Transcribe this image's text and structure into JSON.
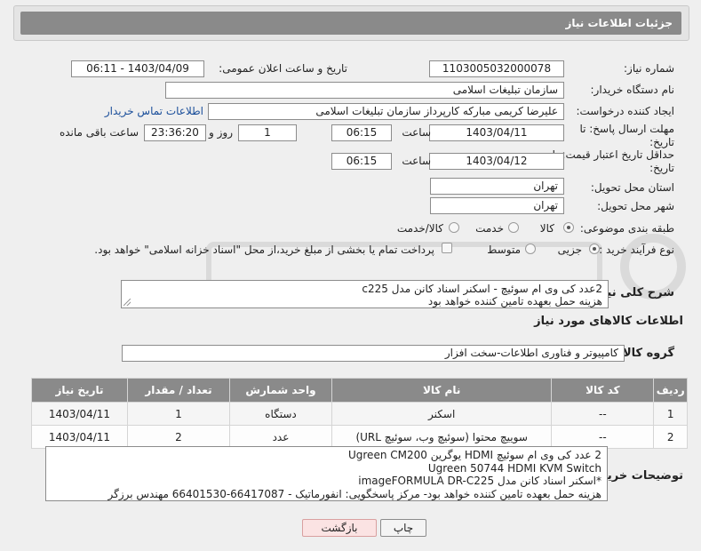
{
  "panel": {
    "title": "جزئیات اطلاعات نیاز"
  },
  "labels": {
    "need_number": "شماره نیاز:",
    "announce_datetime": "تاریخ و ساعت اعلان عمومی:",
    "buyer_org": "نام دستگاه خریدار:",
    "requester": "ایجاد کننده درخواست:",
    "reply_deadline": "مهلت ارسال پاسخ: تا تاریخ:",
    "price_validity": "حداقل تاریخ اعتبار قیمت: تا تاریخ:",
    "hour": "ساعت",
    "day_and": "روز و",
    "remaining": "ساعت باقی مانده",
    "province": "استان محل تحویل:",
    "city": "شهر محل تحویل:",
    "category": "طبقه بندی موضوعی:",
    "purchase_type": "نوع فرآیند خرید :",
    "need_summary": "شرح کلی نیاز:",
    "goods_info": "اطلاعات کالاهای مورد نیاز",
    "goods_group": "گروه کالا:",
    "buyer_notes": "توضیحات خریدار:"
  },
  "fields": {
    "need_number": "1103005032000078",
    "announce_datetime": "1403/04/09 - 06:11",
    "buyer_org": "سازمان تبلیغات اسلامی",
    "requester": "علیرضا کریمی مبارکه کارپرداز سازمان تبلیغات اسلامی",
    "buyer_contact_link": "اطلاعات تماس خریدار",
    "reply_date": "1403/04/11",
    "reply_time": "06:15",
    "reply_days": "1",
    "reply_remaining": "23:36:20",
    "validity_date": "1403/04/12",
    "validity_time": "06:15",
    "province": "تهران",
    "city": "تهران",
    "goods_group": "کامپیوتر و فناوری اطلاعات-سخت افزار"
  },
  "category_options": [
    "کالا",
    "خدمت",
    "کالا/خدمت"
  ],
  "category_selected": "کالا",
  "purchase_options": [
    "جزیی",
    "متوسط"
  ],
  "purchase_selected": "جزیی",
  "payment_note": "پرداخت تمام یا بخشی از مبلغ خرید،از محل \"اسناد خزانه اسلامی\" خواهد بود.",
  "need_summary_lines": [
    "2عدد کی وی ام سوئیچ - اسکنر اسناد کانن مدل c225",
    "هزینه حمل بعهده تامین کننده خواهد بود"
  ],
  "table": {
    "headers": [
      "ردیف",
      "کد کالا",
      "نام کالا",
      "واحد شمارش",
      "تعداد / مقدار",
      "تاریخ نیاز"
    ],
    "rows": [
      [
        "1",
        "--",
        "اسکنر",
        "دستگاه",
        "1",
        "1403/04/11"
      ],
      [
        "2",
        "--",
        "سوییچ محتوا (سوئیچ وب، سوئیچ URL)",
        "عدد",
        "2",
        "1403/04/11"
      ]
    ]
  },
  "buyer_notes_lines": [
    "2 عدد کی وی ام سوئیچ HDMI یوگرین Ugreen CM200",
    "Ugreen 50744 HDMI KVM Switch",
    "*اسکنر اسناد کانن مدل imageFORMULA DR-C225",
    "هزینه حمل بعهده تامین کننده خواهد بود- مرکز پاسخگویی: انفورماتیک - 66417087-66401530 مهندس برزگر"
  ],
  "buttons": {
    "print": "چاپ",
    "back": "بازگشت"
  },
  "colors": {
    "header_gray": "#8a8a8a",
    "link_blue": "#1a4e9a",
    "back_button_pink": "#fbe3e3"
  }
}
